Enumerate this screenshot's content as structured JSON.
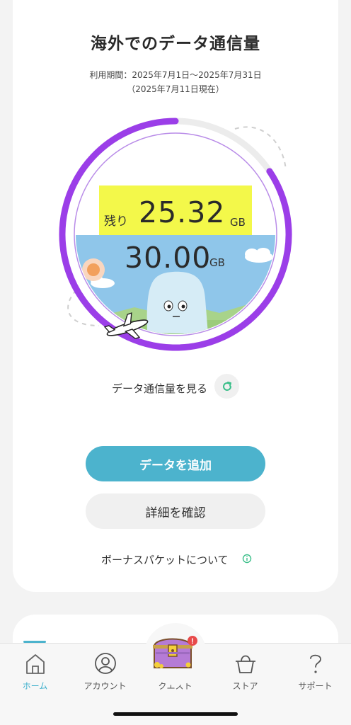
{
  "header": {
    "title": "海外でのデータ通信量",
    "period": "利用期間：2025年7月1日〜2025年7月31日",
    "as_of": "（2025年7月11日現在）"
  },
  "gauge": {
    "remaining_label": "残り",
    "remaining_value": "25.32",
    "remaining_unit": "GB",
    "total_value": "30.00",
    "total_unit": "GB",
    "remaining_fraction": 0.844,
    "colors": {
      "ring": "#9b3ee8",
      "track": "#ececec",
      "sky": "#8fc6ea",
      "grass": "#9ccc7a",
      "highlight": "#f3f84a"
    }
  },
  "actions": {
    "view_usage_label": "データ通信量を見る",
    "refresh_icon": "refresh-icon",
    "add_data_label": "データを追加",
    "details_label": "詳細を確認",
    "bonus_label": "ボーナスパケットについて",
    "info_icon": "info-icon",
    "primary_color": "#4cb3cd"
  },
  "nav": {
    "items": [
      {
        "label": "ホーム",
        "icon": "home-icon",
        "active": true
      },
      {
        "label": "アカウント",
        "icon": "account-icon",
        "active": false
      },
      {
        "label": "クエスト",
        "icon": "treasure-chest-icon",
        "active": false,
        "badge": "!"
      },
      {
        "label": "ストア",
        "icon": "basket-icon",
        "active": false
      },
      {
        "label": "サポート",
        "icon": "question-icon",
        "active": false
      }
    ],
    "active_color": "#3fb0cd"
  }
}
